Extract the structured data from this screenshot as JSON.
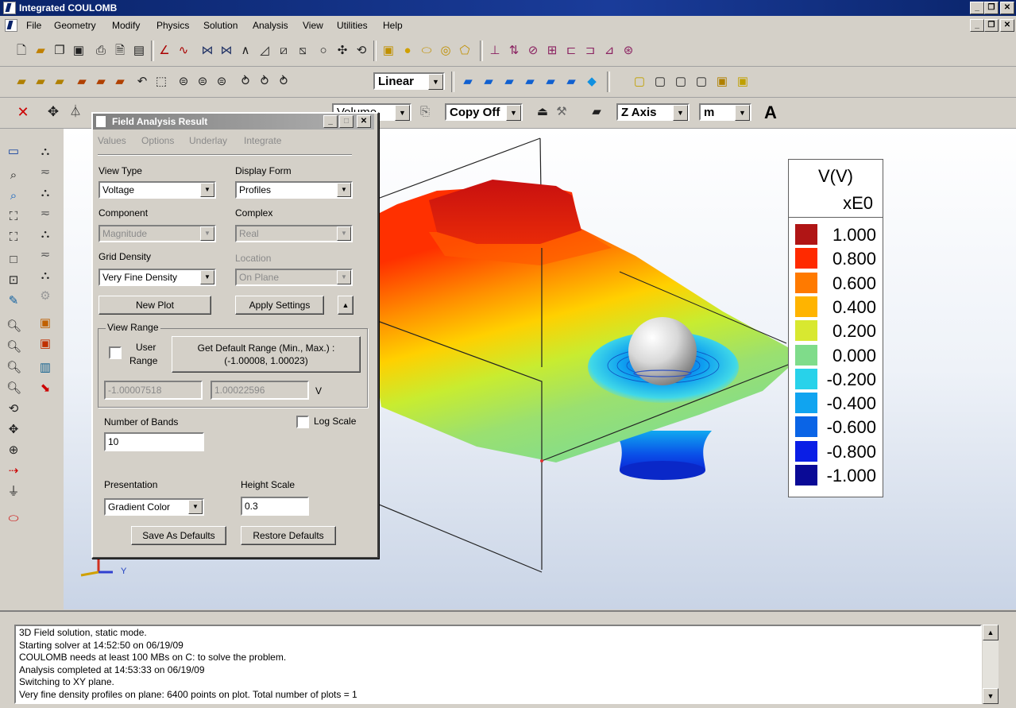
{
  "window": {
    "title": "Integrated COULOMB"
  },
  "menu": [
    "File",
    "Geometry",
    "Modify",
    "Physics",
    "Solution",
    "Analysis",
    "View",
    "Utilities",
    "Help"
  ],
  "toolbar": {
    "interpolation": "Linear",
    "copy_mode": "Copy Off",
    "axis": "Z Axis",
    "units": "m",
    "obscured_combo": "Volume",
    "text_tool": "A"
  },
  "dialog": {
    "title": "Field Analysis Result",
    "menu": [
      "Values",
      "Options",
      "Underlay",
      "Integrate"
    ],
    "view_type_label": "View Type",
    "view_type": "Voltage",
    "display_form_label": "Display Form",
    "display_form": "Profiles",
    "component_label": "Component",
    "component": "Magnitude",
    "complex_label": "Complex",
    "complex": "Real",
    "grid_density_label": "Grid Density",
    "grid_density": "Very Fine Density",
    "location_label": "Location",
    "location": "On Plane",
    "new_plot": "New Plot",
    "apply_settings": "Apply Settings",
    "view_range_label": "View Range",
    "user_range_label_1": "User",
    "user_range_label_2": "Range",
    "default_range_btn_1": "Get Default Range (Min., Max.) :",
    "default_range_btn_2": "(-1.00008, 1.00023)",
    "range_min": "-1.00007518",
    "range_max": "1.00022596",
    "range_unit": "V",
    "bands_label": "Number of Bands",
    "bands": "10",
    "log_scale_label": "Log Scale",
    "presentation_label": "Presentation",
    "presentation": "Gradient Color",
    "height_scale_label": "Height Scale",
    "height_scale": "0.3",
    "save_defaults": "Save As Defaults",
    "restore_defaults": "Restore Defaults"
  },
  "legend": {
    "title": "V(V)",
    "scale": "xE0",
    "entries": [
      {
        "value": "1.000",
        "color": "#b01515"
      },
      {
        "value": "0.800",
        "color": "#ff2a00"
      },
      {
        "value": "0.600",
        "color": "#ff7a00"
      },
      {
        "value": "0.400",
        "color": "#ffb400"
      },
      {
        "value": "0.200",
        "color": "#d8e830"
      },
      {
        "value": "0.000",
        "color": "#7fdc8a"
      },
      {
        "value": "-0.200",
        "color": "#28d2ea"
      },
      {
        "value": "-0.400",
        "color": "#10a4f0"
      },
      {
        "value": "-0.600",
        "color": "#0a64e6"
      },
      {
        "value": "-0.800",
        "color": "#0a1ee6"
      },
      {
        "value": "-1.000",
        "color": "#0a0a96"
      }
    ]
  },
  "axis_label": "Y",
  "console": [
    "3D Field solution, static mode.",
    "Starting solver at 14:52:50 on 06/19/09",
    "COULOMB needs at least 100 MBs on C: to solve the problem.",
    "Analysis completed at 14:53:33 on 06/19/09",
    "Switching to XY plane.",
    "Very fine density profiles on plane: 6400 points on plot.   Total number of plots = 1"
  ]
}
